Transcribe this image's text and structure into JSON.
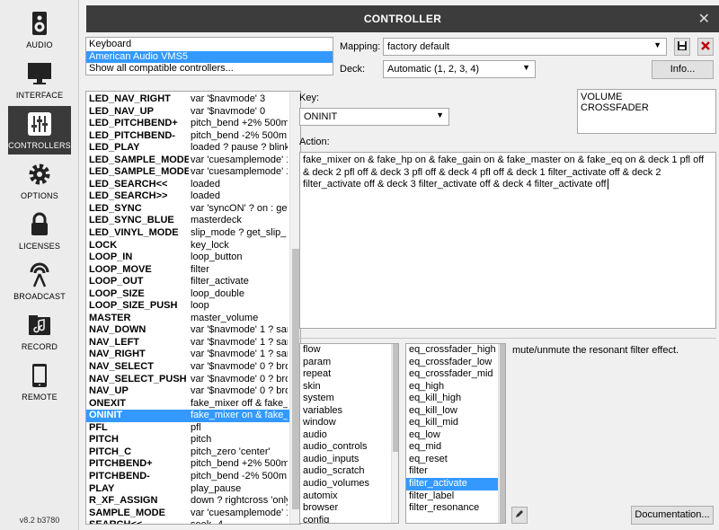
{
  "sidebar": {
    "items": [
      {
        "label": "AUDIO",
        "icon": "speaker-icon"
      },
      {
        "label": "INTERFACE",
        "icon": "monitor-icon"
      },
      {
        "label": "CONTROLLERS",
        "icon": "sliders-icon"
      },
      {
        "label": "OPTIONS",
        "icon": "gear-icon"
      },
      {
        "label": "LICENSES",
        "icon": "lock-icon"
      },
      {
        "label": "BROADCAST",
        "icon": "broadcast-icon"
      },
      {
        "label": "RECORD",
        "icon": "record-folder-icon"
      },
      {
        "label": "REMOTE",
        "icon": "tablet-icon"
      }
    ],
    "active": "CONTROLLERS",
    "version": "v8.2 b3780"
  },
  "window": {
    "title": "CONTROLLER",
    "close": "✕"
  },
  "devices": {
    "items": [
      "Keyboard",
      "American Audio VMS5",
      "Show all compatible controllers..."
    ],
    "selected": "American Audio VMS5"
  },
  "mapping": {
    "label": "Mapping:",
    "value": "factory default",
    "save_icon": "save-icon",
    "delete_icon": "delete-icon"
  },
  "deck": {
    "label": "Deck:",
    "value": "Automatic (1, 2, 3, 4)"
  },
  "info_button": "Info...",
  "mappings": [
    {
      "key": "LED_NAV_RIGHT",
      "action": "var '$navmode' 3"
    },
    {
      "key": "LED_NAV_UP",
      "action": "var '$navmode' 0"
    },
    {
      "key": "LED_PITCHBEND+",
      "action": "pitch_bend +2% 500m"
    },
    {
      "key": "LED_PITCHBEND-",
      "action": "pitch_bend -2% 500m"
    },
    {
      "key": "LED_PLAY",
      "action": "loaded ? pause ? blink"
    },
    {
      "key": "LED_SAMPLE_MODE",
      "action": "var 'cuesamplemode' 1"
    },
    {
      "key": "LED_SAMPLE_MODE_B",
      "action": "var 'cuesamplemode' 1"
    },
    {
      "key": "LED_SEARCH<<",
      "action": "loaded"
    },
    {
      "key": "LED_SEARCH>>",
      "action": "loaded"
    },
    {
      "key": "LED_SYNC",
      "action": "var 'syncON' ? on : get_"
    },
    {
      "key": "LED_SYNC_BLUE",
      "action": "masterdeck"
    },
    {
      "key": "LED_VINYL_MODE",
      "action": "slip_mode ? get_slip_"
    },
    {
      "key": "LOCK",
      "action": "key_lock"
    },
    {
      "key": "LOOP_IN",
      "action": "loop_button"
    },
    {
      "key": "LOOP_MOVE",
      "action": "filter"
    },
    {
      "key": "LOOP_OUT",
      "action": "filter_activate"
    },
    {
      "key": "LOOP_SIZE",
      "action": "loop_double"
    },
    {
      "key": "LOOP_SIZE_PUSH",
      "action": "loop"
    },
    {
      "key": "MASTER",
      "action": "master_volume"
    },
    {
      "key": "NAV_DOWN",
      "action": "var '$navmode' 1 ? sar"
    },
    {
      "key": "NAV_LEFT",
      "action": "var '$navmode' 1 ? sar"
    },
    {
      "key": "NAV_RIGHT",
      "action": "var '$navmode' 1 ? sar"
    },
    {
      "key": "NAV_SELECT",
      "action": "var '$navmode' 0 ? bro"
    },
    {
      "key": "NAV_SELECT_PUSH",
      "action": "var '$navmode' 0 ? bro"
    },
    {
      "key": "NAV_UP",
      "action": "var '$navmode' 0 ? bro"
    },
    {
      "key": "ONEXIT",
      "action": "fake_mixer off & fake_"
    },
    {
      "key": "ONINIT",
      "action": "fake_mixer on & fake_"
    },
    {
      "key": "PFL",
      "action": "pfl"
    },
    {
      "key": "PITCH",
      "action": "pitch"
    },
    {
      "key": "PITCH_C",
      "action": "pitch_zero 'center'"
    },
    {
      "key": "PITCHBEND+",
      "action": "pitch_bend +2% 500m"
    },
    {
      "key": "PITCHBEND-",
      "action": "pitch_bend -2% 500m"
    },
    {
      "key": "PLAY",
      "action": "play_pause"
    },
    {
      "key": "R_XF_ASSIGN",
      "action": "down ? rightcross 'only"
    },
    {
      "key": "SAMPLE_MODE",
      "action": "var 'cuesamplemode' 1"
    },
    {
      "key": "SEARCH<<",
      "action": "seek -4"
    }
  ],
  "selected_mapping": "ONINIT",
  "key": {
    "label": "Key:",
    "value": "ONINIT"
  },
  "key_list": [
    "VOLUME",
    "CROSSFADER"
  ],
  "action": {
    "label": "Action:",
    "text": "fake_mixer on & fake_hp on & fake_gain on & fake_master on & fake_eq on & deck 1 pfl off & deck 2 pfl off  & deck 3 pfl off  & deck 4 pfl off & deck 1 filter_activate off & deck 2 filter_activate off & deck 3 filter_activate off & deck 4 filter_activate off"
  },
  "categories": [
    "flow",
    "param",
    "repeat",
    "skin",
    "system",
    "variables",
    "window",
    "audio",
    "audio_controls",
    "audio_inputs",
    "audio_scratch",
    "audio_volumes",
    "automix",
    "browser",
    "config"
  ],
  "verbs": [
    "eq_crossfader_high",
    "eq_crossfader_low",
    "eq_crossfader_mid",
    "eq_high",
    "eq_kill_high",
    "eq_kill_low",
    "eq_kill_mid",
    "eq_low",
    "eq_mid",
    "eq_reset",
    "filter",
    "filter_activate",
    "filter_label",
    "filter_resonance"
  ],
  "selected_verb": "filter_activate",
  "verb_description": "mute/unmute the resonant filter effect.",
  "edit_icon": "pencil-icon",
  "documentation_button": "Documentation..."
}
